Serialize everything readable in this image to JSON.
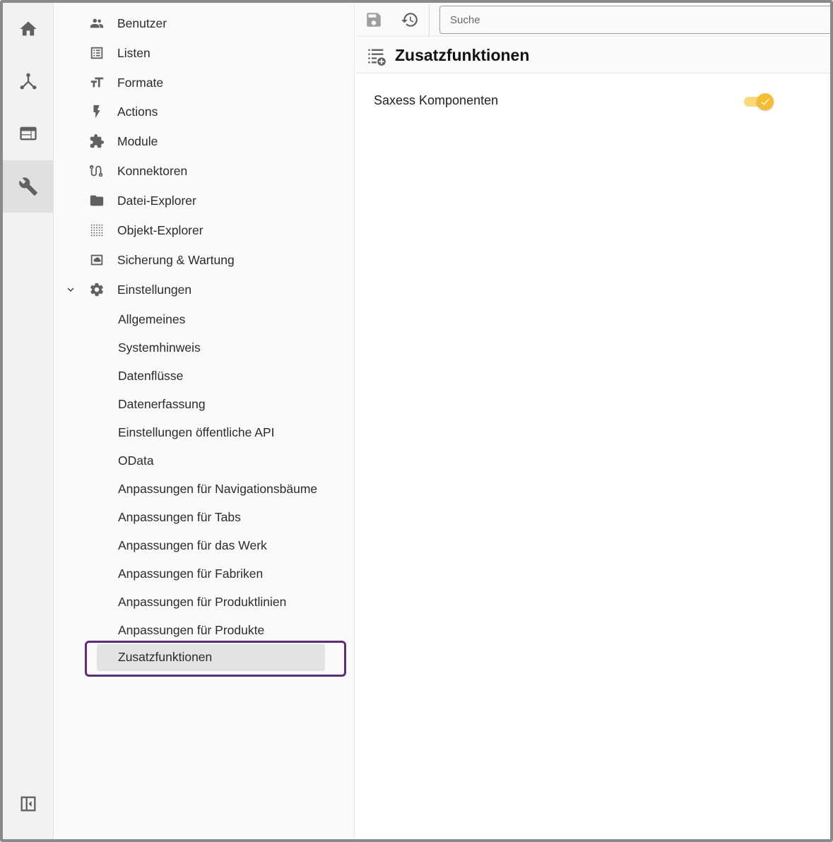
{
  "rail": {
    "items": [
      {
        "icon": "home-icon"
      },
      {
        "icon": "hierarchy-icon"
      },
      {
        "icon": "web-view-icon"
      },
      {
        "icon": "wrench-icon",
        "active": true
      }
    ],
    "collapse_icon": "collapse-sidebar-icon"
  },
  "sidebar": {
    "items": [
      {
        "label": "Benutzer",
        "icon": "users-icon"
      },
      {
        "label": "Listen",
        "icon": "list-icon"
      },
      {
        "label": "Formate",
        "icon": "text-format-icon"
      },
      {
        "label": "Actions",
        "icon": "bolt-icon"
      },
      {
        "label": "Module",
        "icon": "puzzle-icon"
      },
      {
        "label": "Konnektoren",
        "icon": "route-icon"
      },
      {
        "label": "Datei-Explorer",
        "icon": "folder-icon"
      },
      {
        "label": "Objekt-Explorer",
        "icon": "dot-grid-icon"
      },
      {
        "label": "Sicherung & Wartung",
        "icon": "backup-icon"
      },
      {
        "label": "Einstellungen",
        "icon": "gear-icon",
        "expanded": true
      }
    ],
    "sub_items": [
      {
        "label": "Allgemeines"
      },
      {
        "label": "Systemhinweis"
      },
      {
        "label": "Datenflüsse"
      },
      {
        "label": "Datenerfassung"
      },
      {
        "label": "Einstellungen öffentliche API"
      },
      {
        "label": "OData"
      },
      {
        "label": "Anpassungen für Navigationsbäume"
      },
      {
        "label": "Anpassungen für Tabs"
      },
      {
        "label": "Anpassungen für das Werk"
      },
      {
        "label": "Anpassungen für Fabriken"
      },
      {
        "label": "Anpassungen für Produktlinien"
      },
      {
        "label": "Anpassungen für Produkte"
      },
      {
        "label": "Zusatzfunktionen",
        "selected": true
      }
    ]
  },
  "toolbar": {
    "save_icon": "save-icon",
    "history_icon": "restore-icon",
    "search_placeholder": "Suche"
  },
  "page": {
    "icon": "list-add-icon",
    "title": "Zusatzfunktionen"
  },
  "settings": [
    {
      "label": "Saxess Komponenten",
      "enabled": true
    }
  ],
  "colors": {
    "accent": "#f6bd32",
    "accent_track": "#fbd977",
    "annotation": "#5c2d7e",
    "selected_bg": "#e3e3e3"
  }
}
